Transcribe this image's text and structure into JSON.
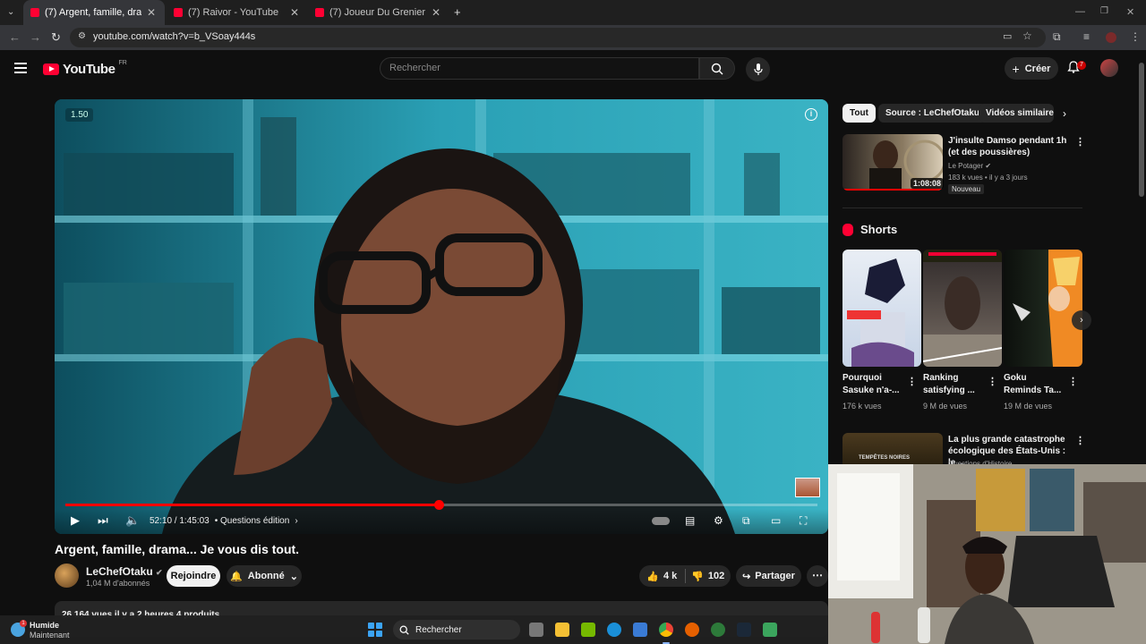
{
  "browser": {
    "tabs": [
      {
        "title": "(7) Argent, famille, drama... Je vous dis tout.",
        "active": true
      },
      {
        "title": "(7) Raivor - YouTube",
        "active": false
      },
      {
        "title": "(7) Joueur Du Grenier - YouTube",
        "active": false
      }
    ],
    "url": "youtube.com/watch?v=b_VSoay444s",
    "new_tab": "+"
  },
  "masthead": {
    "logo_text": "YouTube",
    "country_code": "FR",
    "search_placeholder": "Rechercher",
    "create_label": "Créer",
    "notification_count": "7"
  },
  "player": {
    "speed_label": "1.50",
    "current_time": "52:10",
    "duration": "1:45:03",
    "chapter": "• Questions édition",
    "progress": 0.497,
    "accent": "#ff0000"
  },
  "video": {
    "title": "Argent, famille, drama... Je vous dis tout.",
    "channel": "LeChefOtaku",
    "subscribers": "1,04 M d'abonnés",
    "join_label": "Rejoindre",
    "subscribe_label": "Abonné",
    "likes": "4 k",
    "dislikes": "102",
    "share_label": "Partager",
    "description_meta": "26 164 vues  il y a 2 heures  4 produits"
  },
  "sidebar": {
    "chips": [
      "Tout",
      "Source : LeChefOtaku",
      "Vidéos similaires"
    ],
    "rec1": {
      "title": "J'insulte Damso pendant 1h (et des poussières)",
      "channel": "Le Potager",
      "meta": "183 k vues • il y a 3 jours",
      "badge": "Nouveau",
      "duration": "1:08:08"
    },
    "shorts_header": "Shorts",
    "shorts": [
      {
        "title": "Pourquoi Sasuke n'a-...",
        "views": "176 k vues"
      },
      {
        "title": "Ranking satisfying ...",
        "views": "9 M de vues"
      },
      {
        "title": "Goku Reminds Ta...",
        "views": "19 M de vues"
      }
    ],
    "rec2": {
      "title": "La plus grande catastrophe écologique des États-Unis : le ...",
      "channel": "Questions d'Histoire",
      "thumb_text": "TEMPÊTES NOIRES"
    }
  },
  "taskbar": {
    "weather_main": "Humide",
    "weather_sub": "Maintenant",
    "weather_badge": "1",
    "search_label": "Rechercher"
  }
}
